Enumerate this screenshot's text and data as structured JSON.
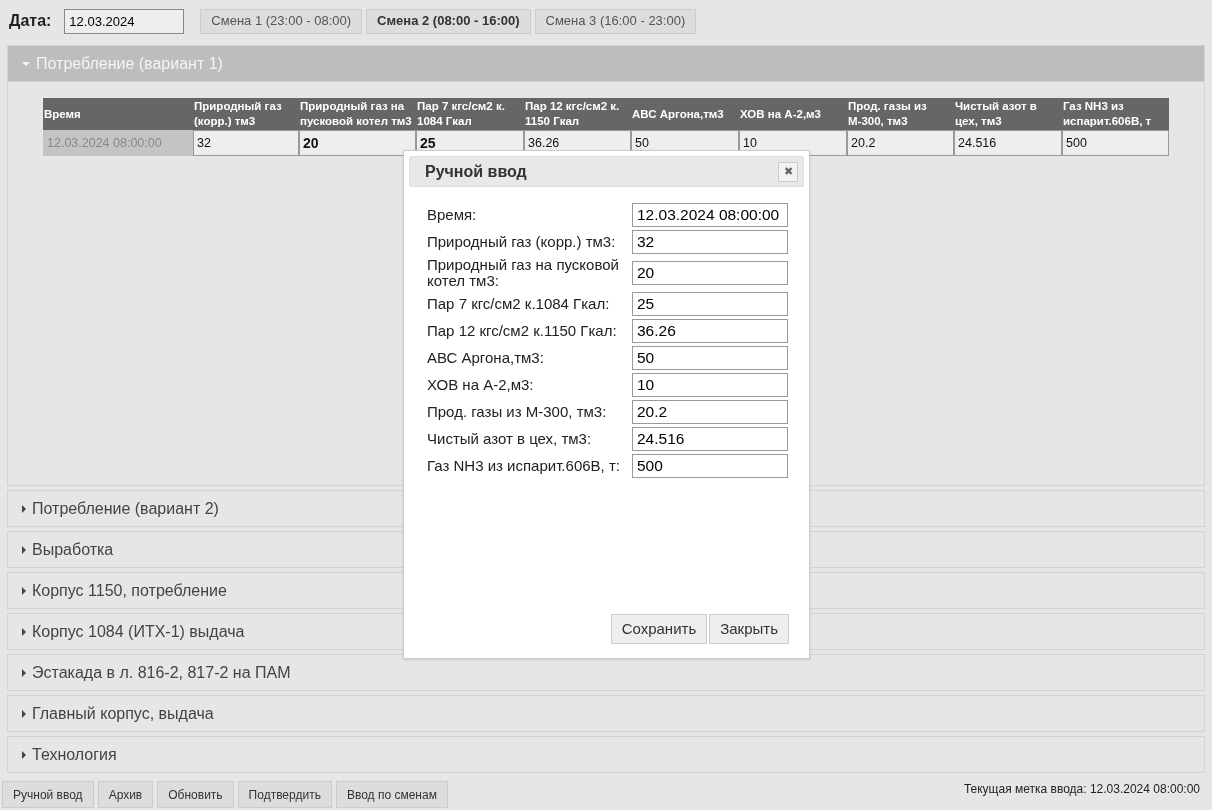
{
  "toolbar": {
    "date_label": "Дата:",
    "date_value": "12.03.2024",
    "shifts": [
      {
        "label": "Смена 1 (23:00 - 08:00)",
        "selected": false
      },
      {
        "label": "Смена 2 (08:00 - 16:00)",
        "selected": true
      },
      {
        "label": "Смена 3 (16:00 - 23:00)",
        "selected": false
      }
    ]
  },
  "sections": [
    {
      "title": "Потребление (вариант 1)",
      "expanded": true,
      "table": {
        "columns": [
          "Время",
          "Природный газ (корр.) тм3",
          "Природный газ на пусковой котел тм3",
          "Пар 7 кгс/см2 к. 1084 Гкал",
          "Пар 12 кгс/см2 к. 1150 Гкал",
          "АВС Аргона,тм3",
          "ХОВ на А-2,м3",
          "Прод. газы из М-300, тм3",
          "Чистый азот в цех, тм3",
          "Газ NH3 из испарит.606В, т"
        ],
        "rows": [
          {
            "cells": [
              {
                "value": "12.03.2024 08:00:00",
                "modified": false,
                "kind": "time"
              },
              {
                "value": "32",
                "modified": false,
                "kind": "value"
              },
              {
                "value": "20",
                "modified": true,
                "kind": "value"
              },
              {
                "value": "25",
                "modified": true,
                "kind": "value"
              },
              {
                "value": "36.26",
                "modified": false,
                "kind": "value"
              },
              {
                "value": "50",
                "modified": false,
                "kind": "value"
              },
              {
                "value": "10",
                "modified": false,
                "kind": "value"
              },
              {
                "value": "20.2",
                "modified": false,
                "kind": "value"
              },
              {
                "value": "24.516",
                "modified": false,
                "kind": "value"
              },
              {
                "value": "500",
                "modified": false,
                "kind": "value"
              }
            ]
          }
        ]
      }
    },
    {
      "title": "Потребление (вариант 2)",
      "expanded": false
    },
    {
      "title": "Выработка",
      "expanded": false
    },
    {
      "title": "Корпус 1150, потребление",
      "expanded": false
    },
    {
      "title": "Корпус 1084 (ИТХ-1) выдача",
      "expanded": false
    },
    {
      "title": "Эстакада в л. 816-2, 817-2 на ПАМ",
      "expanded": false
    },
    {
      "title": "Главный корпус, выдача",
      "expanded": false
    },
    {
      "title": "Технология",
      "expanded": false
    }
  ],
  "dialog": {
    "title": "Ручной ввод",
    "close": "✖",
    "fields": [
      {
        "label": "Время:",
        "value": "12.03.2024 08:00:00"
      },
      {
        "label": "Природный газ (корр.) тм3:",
        "value": "32"
      },
      {
        "label": "Природный газ на пусковой котел тм3:",
        "value": "20"
      },
      {
        "label": "Пар 7 кгс/см2 к.1084 Гкал:",
        "value": "25"
      },
      {
        "label": "Пар 12 кгс/см2 к.1150 Гкал:",
        "value": "36.26"
      },
      {
        "label": "АВС Аргона,тм3:",
        "value": "50"
      },
      {
        "label": "ХОВ на А-2,м3:",
        "value": "10"
      },
      {
        "label": "Прод. газы из М-300, тм3:",
        "value": "20.2"
      },
      {
        "label": "Чистый азот в цех, тм3:",
        "value": "24.516"
      },
      {
        "label": "Газ NH3 из испарит.606В, т:",
        "value": "500"
      }
    ],
    "buttons": [
      "Сохранить",
      "Закрыть"
    ]
  },
  "bottom_buttons": [
    "Ручной ввод",
    "Архив",
    "Обновить",
    "Подтвердить",
    "Ввод по сменам"
  ],
  "status": "Текущая метка ввода: 12.03.2024 08:00:00"
}
